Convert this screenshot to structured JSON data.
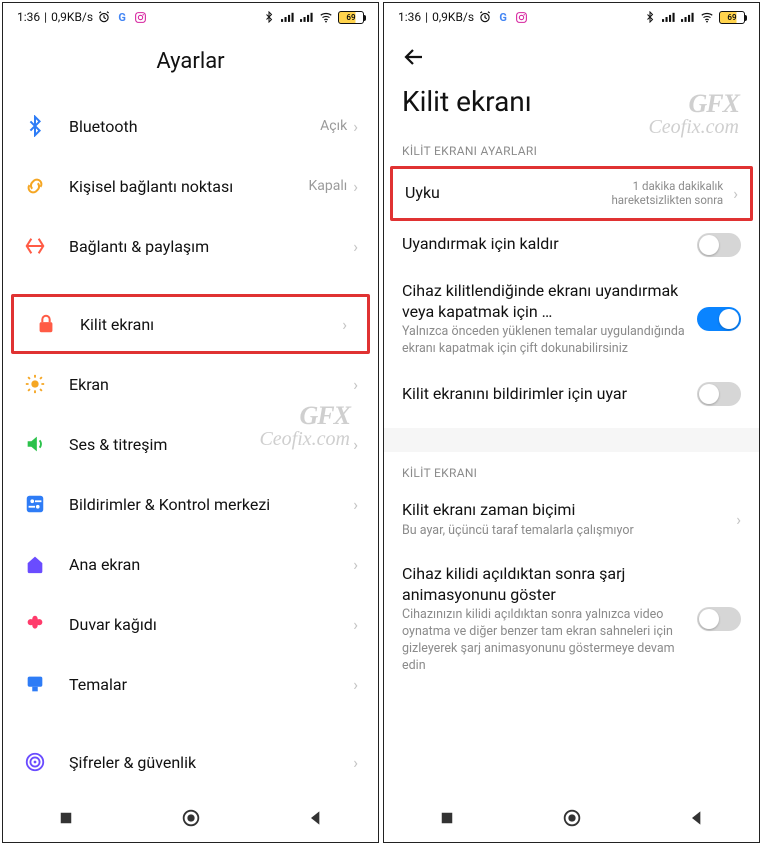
{
  "status": {
    "time": "1:36",
    "speed": "0,9KB/s",
    "battery": "69"
  },
  "left": {
    "title": "Ayarlar",
    "items": [
      {
        "key": "bluetooth",
        "label": "Bluetooth",
        "value": "Açık",
        "color": "#2e7cf6"
      },
      {
        "key": "hotspot",
        "label": "Kişisel bağlantı noktası",
        "value": "Kapalı",
        "color": "#f5a623"
      },
      {
        "key": "tether",
        "label": "Bağlantı & paylaşım",
        "value": "",
        "color": "#ff5b45"
      },
      {
        "key": "lock",
        "label": "Kilit ekranı",
        "value": "",
        "color": "#ff5b45",
        "highlight": true
      },
      {
        "key": "display",
        "label": "Ekran",
        "value": "",
        "color": "#f5a623"
      },
      {
        "key": "sound",
        "label": "Ses & titreşim",
        "value": "",
        "color": "#2bc24b"
      },
      {
        "key": "notif",
        "label": "Bildirimler & Kontrol merkezi",
        "value": "",
        "color": "#2e7cf6"
      },
      {
        "key": "home",
        "label": "Ana ekran",
        "value": "",
        "color": "#6a4cff"
      },
      {
        "key": "wall",
        "label": "Duvar kağıdı",
        "value": "",
        "color": "#ff3b6b"
      },
      {
        "key": "themes",
        "label": "Temalar",
        "value": "",
        "color": "#2e7cf6"
      },
      {
        "key": "security",
        "label": "Şifreler & güvenlik",
        "value": "",
        "color": "#6a4cff"
      }
    ]
  },
  "right": {
    "title": "Kilit ekranı",
    "section1": "KİLİT EKRANI AYARLARI",
    "section2": "KİLİT EKRANI",
    "sleep": {
      "label": "Uyku",
      "value": "1 dakika dakikalık hareketsizlikten sonra"
    },
    "raise": {
      "label": "Uyandırmak için kaldır",
      "on": false
    },
    "doubletap": {
      "label": "Cihaz kilitlendiğinde ekranı uyandırmak veya kapatmak için …",
      "desc": "Yalnızca önceden yüklenen temalar uygulandığında ekranı kapatmak için çift dokunabilirsiniz",
      "on": true
    },
    "notify": {
      "label": "Kilit ekranını bildirimler için uyar",
      "on": false
    },
    "clockfmt": {
      "label": "Kilit ekranı zaman biçimi",
      "desc": "Bu ayar, üçüncü taraf temalarla çalışmıyor"
    },
    "chargeanim": {
      "label": "Cihaz kilidi açıldıktan sonra şarj animasyonunu göster",
      "desc": "Cihazınızın kilidi açıldıktan sonra yalnızca video oynatma ve diğer benzer tam ekran sahneleri için gizleyerek şarj animasyonunu göstermeye devam edin",
      "on": false
    }
  },
  "watermark": {
    "brand": "GFX",
    "site": "Ceofix.com"
  }
}
